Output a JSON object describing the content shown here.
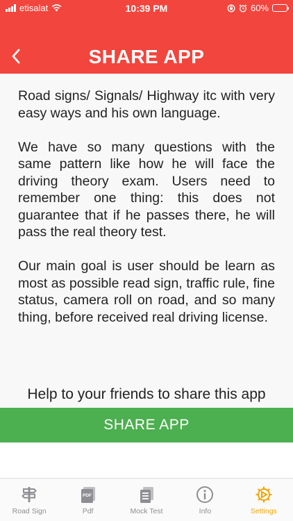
{
  "status_bar": {
    "carrier": "etisalat",
    "time": "10:39 PM",
    "battery": "60%",
    "battery_level": 0.6
  },
  "header": {
    "title": "SHARE APP",
    "back_icon": "chevron-left-icon"
  },
  "content": {
    "paragraphs": [
      "Road signs/ Signals/ Highway itc with very easy ways and his own language.",
      "We have so many questions with the same pattern like how he will face the driving theory exam. Users need to remember one thing: this does not guarantee that if he passes there, he will pass the real theory test.",
      "Our main goal is user should be learn as most as possible read sign, traffic rule, fine status, camera roll on road, and so many thing, before received real driving license."
    ],
    "help_text": "Help to your friends to share this app",
    "share_button": "SHARE APP"
  },
  "tabs": [
    {
      "label": "Road Sign",
      "icon": "signpost-icon",
      "active": false
    },
    {
      "label": "Pdf",
      "icon": "pdf-icon",
      "active": false
    },
    {
      "label": "Mock Test",
      "icon": "document-stack-icon",
      "active": false
    },
    {
      "label": "Info",
      "icon": "info-icon",
      "active": false
    },
    {
      "label": "Settings",
      "icon": "gear-icon",
      "active": true
    }
  ],
  "colors": {
    "header": "#f2453d",
    "share_button": "#4caf50",
    "active_tab": "#f0a500",
    "inactive_tab": "#8e8e93"
  }
}
